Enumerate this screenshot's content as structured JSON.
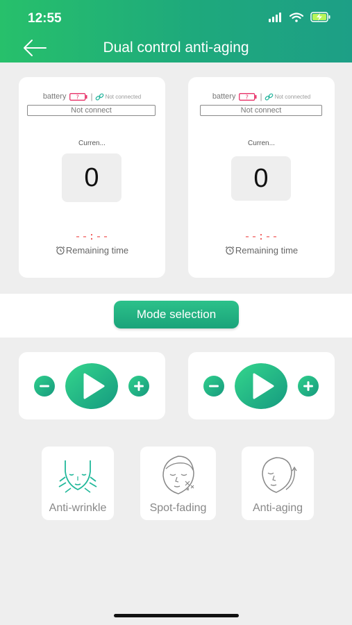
{
  "status_bar": {
    "time": "12:55"
  },
  "header": {
    "title": "Dual control anti-aging"
  },
  "devices": [
    {
      "battery_label": "battery",
      "connection_text": "Not connected",
      "connect_status": "Not connect",
      "current_label": "Curren...",
      "value": "0",
      "timer": "--:--",
      "remaining_label": "Remaining time"
    },
    {
      "battery_label": "battery",
      "connection_text": "Not connected",
      "connect_status": "Not connect",
      "current_label": "Curren...",
      "value": "0",
      "timer": "--:--",
      "remaining_label": "Remaining time"
    }
  ],
  "mode_selection": {
    "label": "Mode selection"
  },
  "modes": [
    {
      "label": "Anti-wrinkle",
      "icon": "face-lift-icon"
    },
    {
      "label": "Spot-fading",
      "icon": "face-spots-icon"
    },
    {
      "label": "Anti-aging",
      "icon": "face-rejuvenate-icon"
    }
  ],
  "colors": {
    "accent": "#1fa87b",
    "header_start": "#27c06b",
    "timer_red": "#ef4b4b",
    "battery_warning": "#e8336a"
  }
}
